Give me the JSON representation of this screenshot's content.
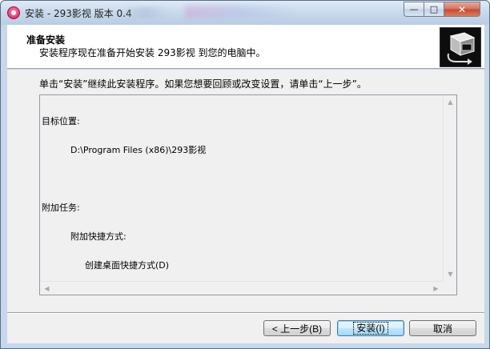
{
  "window": {
    "title": "安装 - 293影视 版本 0.4",
    "minimize_glyph": "—",
    "maximize_glyph": "□",
    "close_glyph": "✕",
    "app_icon": "app-icon"
  },
  "header": {
    "title": "准备安装",
    "subtitle": "安装程序现在准备开始安装 293影视 到您的电脑中。",
    "logo_icon": "installer-box-icon"
  },
  "body": {
    "instruction": "单击“安装”继续此安装程序。如果您想要回顾或改变设置，请单击“上一步”。",
    "memo": {
      "dest_label": "目标位置:",
      "dest_value": "D:\\Program Files (x86)\\293影视",
      "tasks_label": "附加任务:",
      "shortcut_group": "附加快捷方式:",
      "shortcut_item": "创建桌面快捷方式(D)"
    },
    "scroll_up": "▲",
    "scroll_down": "▼",
    "scroll_left": "◀",
    "scroll_right": "▶"
  },
  "footer": {
    "back_label": "< 上一步(B)",
    "install_label": "安装(I)",
    "cancel_label": "取消"
  }
}
